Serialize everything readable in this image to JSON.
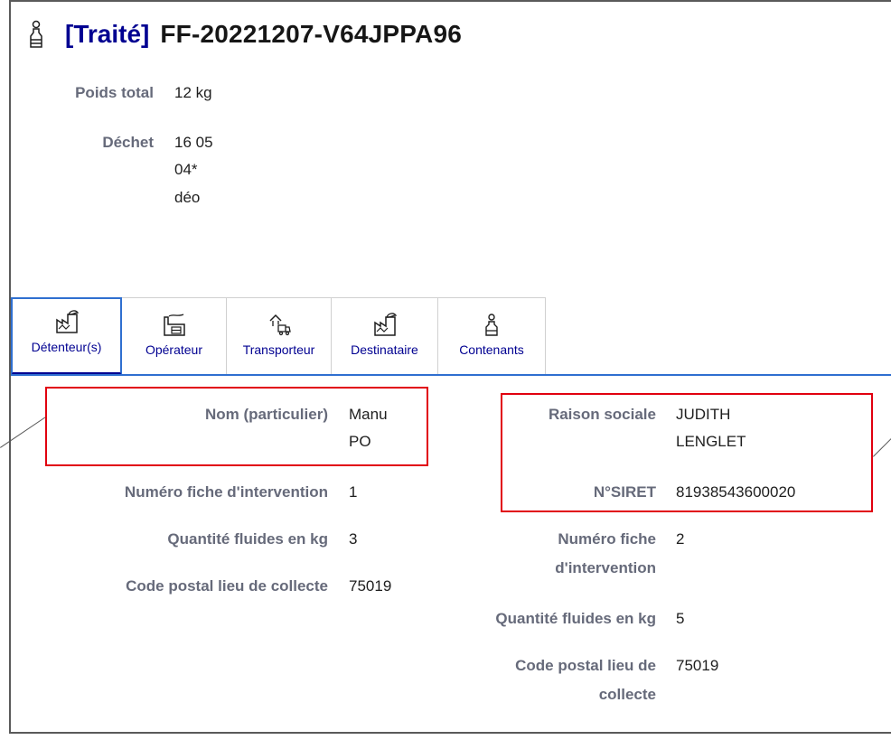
{
  "header": {
    "status": "[Traité]",
    "form_id": "FF-20221207-V64JPPA96"
  },
  "summary": {
    "poids_label": "Poids total",
    "poids_value": "12 kg",
    "dechet_label": "Déchet",
    "dechet_lines": [
      "16 05",
      "04*",
      "déo"
    ]
  },
  "tabs": [
    {
      "label": "Détenteur(s)",
      "icon": "factory-icon",
      "active": true
    },
    {
      "label": "Opérateur",
      "icon": "operator-factory-icon",
      "active": false
    },
    {
      "label": "Transporteur",
      "icon": "truck-icon",
      "active": false
    },
    {
      "label": "Destinataire",
      "icon": "factory-icon",
      "active": false
    },
    {
      "label": "Contenants",
      "icon": "bottle-icon",
      "active": false
    }
  ],
  "detenteur_left": {
    "nom_label": "Nom (particulier)",
    "nom_lines": [
      "Manu",
      "PO"
    ],
    "fiche_label": "Numéro fiche d'intervention",
    "fiche_value": "1",
    "quantite_label": "Quantité fluides en kg",
    "quantite_value": "3",
    "cp_label": "Code postal lieu de collecte",
    "cp_value": "75019"
  },
  "detenteur_right": {
    "raison_label": "Raison sociale",
    "raison_lines": [
      "JUDITH",
      "LENGLET"
    ],
    "siret_label": "N°SIRET",
    "siret_value": "81938543600020",
    "fiche_label_lines": [
      "Numéro fiche",
      "d'intervention"
    ],
    "fiche_value": "2",
    "quantite_label": "Quantité fluides en kg",
    "quantite_value": "5",
    "cp_label_lines": [
      "Code postal lieu de",
      "collecte"
    ],
    "cp_value": "75019"
  },
  "colors": {
    "primary": "#000091",
    "highlight": "#e1000f",
    "label": "#666a7a"
  }
}
